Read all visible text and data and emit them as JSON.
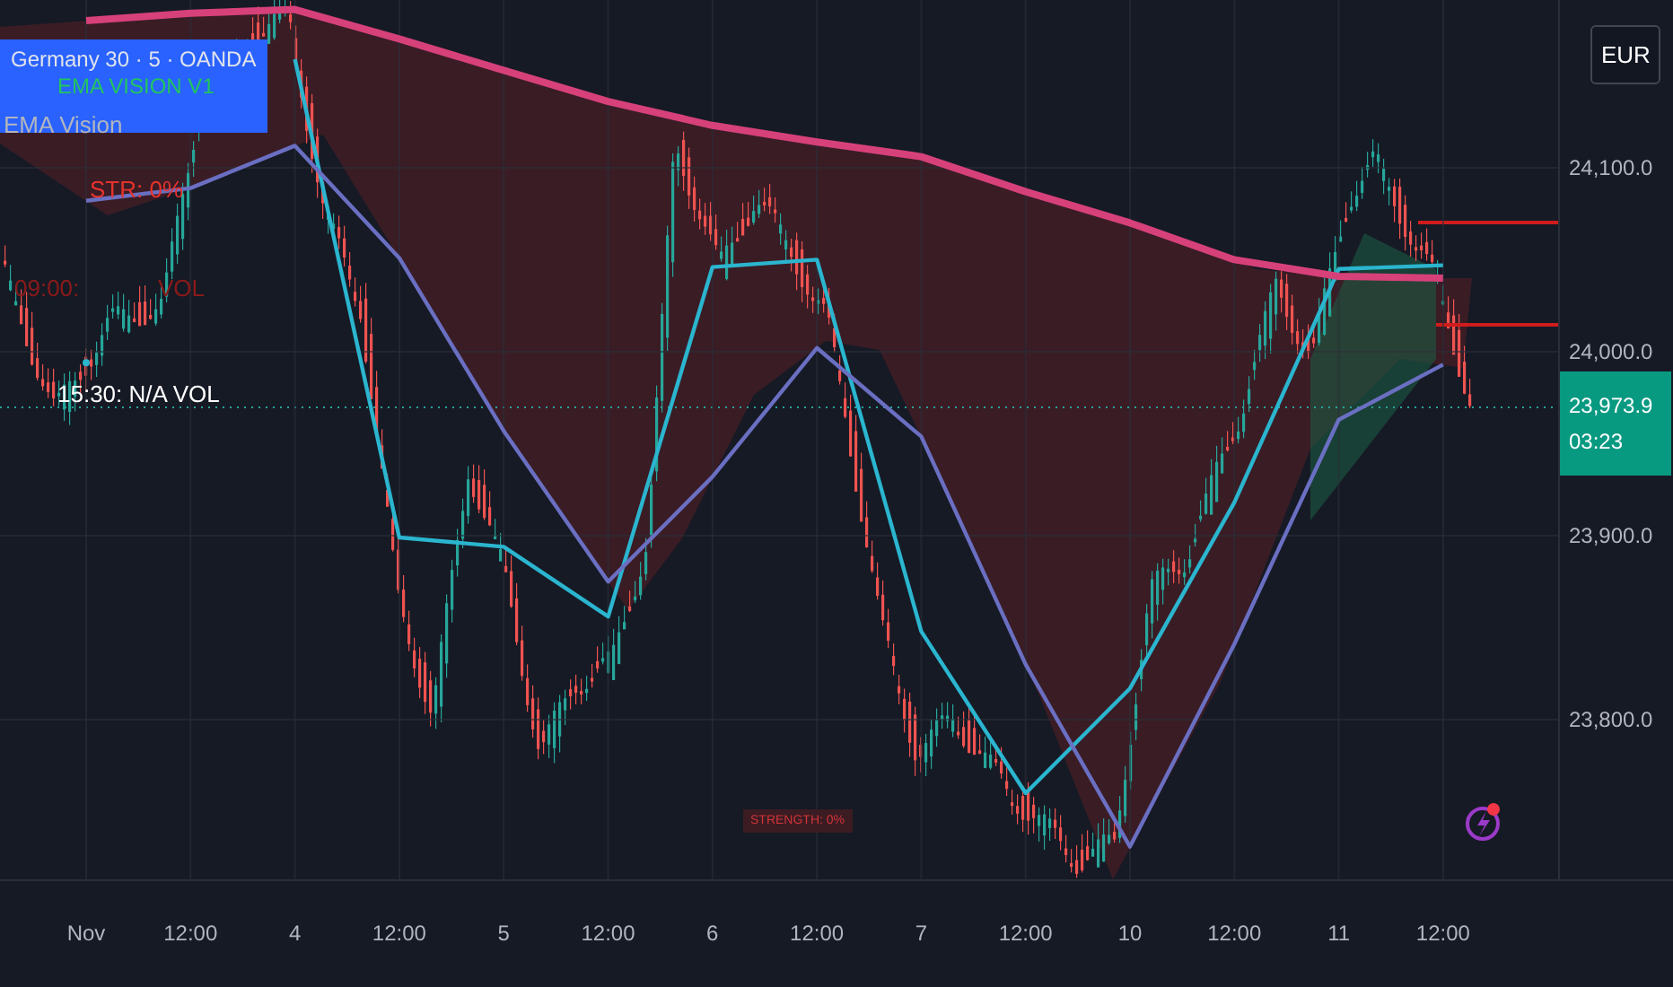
{
  "instrument": {
    "title": "Germany 30 · 5 · OANDA"
  },
  "indicator": {
    "badge": "EMA VISION V1",
    "name": "EMA Vision"
  },
  "labels": [
    {
      "text": "STR: 0%",
      "kind": "strength"
    },
    {
      "text": "09:00:",
      "kind": "muted"
    },
    {
      "text": "VOL",
      "kind": "muted"
    },
    {
      "text": "15:30: N/A VOL",
      "kind": "session"
    }
  ],
  "strength_box": "STRENGTH: 0%",
  "currency": "EUR",
  "current_price": {
    "price": "23,973.9",
    "countdown": "03:23"
  },
  "chart": {
    "chart_data": {
      "type": "line",
      "categories": [
        "Nov",
        "12:00",
        "4",
        "12:00",
        "5",
        "12:00",
        "6",
        "12:00",
        "7",
        "12:00",
        "10",
        "12:00",
        "11",
        "12:00"
      ],
      "series": [
        {
          "color": "#2bb5cf",
          "values": [
            23994,
            null,
            24159,
            23899,
            23894,
            23856,
            24046,
            24050,
            23848,
            23760,
            23817,
            23918,
            24045,
            24047
          ]
        },
        {
          "color": "#6a6fc2",
          "values": [
            24082,
            24089,
            24112,
            24051,
            23957,
            23875,
            23932,
            24002,
            23954,
            23830,
            23731,
            23841,
            23963,
            23993
          ]
        },
        {
          "color": "#d6417a",
          "values": [
            24180,
            24184,
            24186,
            24170,
            24153,
            24136,
            24123,
            24114,
            24106,
            24087,
            24070,
            24050,
            24041,
            24040
          ]
        }
      ],
      "ylim": [
        23713.2,
        24191.2
      ],
      "yticks": [
        {
          "value": 24100,
          "label": "24,100.0"
        },
        {
          "value": 24000,
          "label": "24,000.0"
        },
        {
          "value": 23900,
          "label": "23,900.0"
        },
        {
          "value": 23800,
          "label": "23,800.0"
        }
      ],
      "grid": true
    }
  }
}
